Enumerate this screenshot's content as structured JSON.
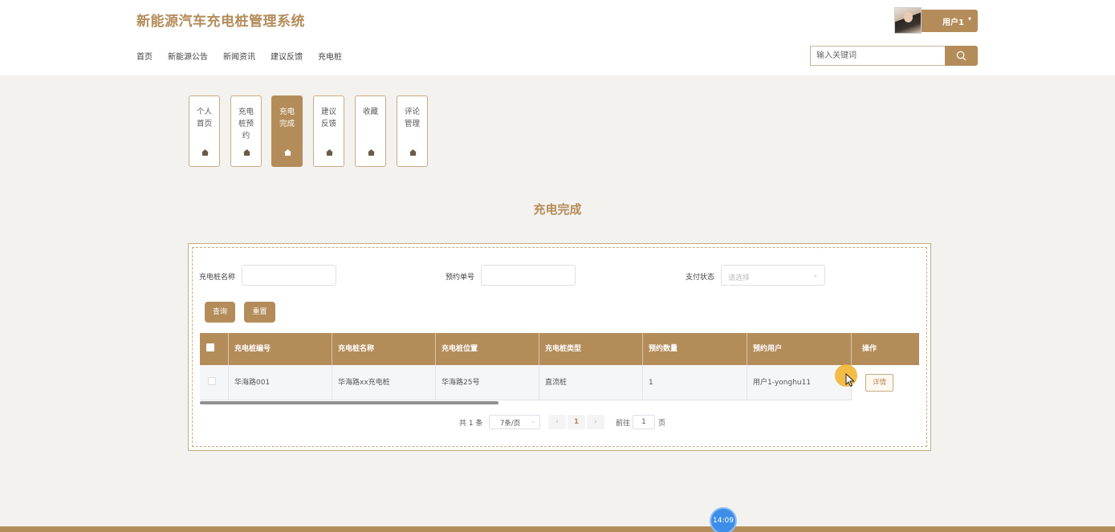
{
  "header": {
    "site_title": "新能源汽车充电桩管理系统",
    "nav": [
      "首页",
      "新能源公告",
      "新闻资讯",
      "建议反馈",
      "充电桩"
    ],
    "user_name": "用户1",
    "user_caret": "▾",
    "search_placeholder": "输入关键词"
  },
  "tabs": [
    {
      "label": "个人首页",
      "active": false
    },
    {
      "label": "充电桩预约",
      "active": false
    },
    {
      "label": "充电完成",
      "active": true
    },
    {
      "label": "建议反馈",
      "active": false
    },
    {
      "label": "收藏",
      "active": false
    },
    {
      "label": "评论管理",
      "active": false
    }
  ],
  "page_heading": "充电完成",
  "filters": {
    "pile_name_label": "充电桩名称",
    "order_no_label": "预约单号",
    "pay_status_label": "支付状态",
    "pay_status_placeholder": "请选择",
    "query_button": "查询",
    "reset_button": "重置"
  },
  "table": {
    "columns": [
      "充电桩编号",
      "充电桩名称",
      "充电桩位置",
      "充电桩类型",
      "预约数量",
      "预约用户",
      "操作"
    ],
    "rows": [
      {
        "cells": [
          "华海路001",
          "华海路xx充电桩",
          "华海路25号",
          "直流桩",
          "1",
          "用户1-yonghu11"
        ],
        "action": "详情"
      }
    ]
  },
  "pagination": {
    "total": "共 1 条",
    "page_size": "7条/页",
    "prev": "‹",
    "next": "›",
    "current_page": "1",
    "goto_label": "前往",
    "goto_value": "1",
    "page_suffix": "页"
  },
  "clock": "14:09",
  "colors": {
    "accent": "#b48c5a",
    "background": "#f4f2ef"
  }
}
